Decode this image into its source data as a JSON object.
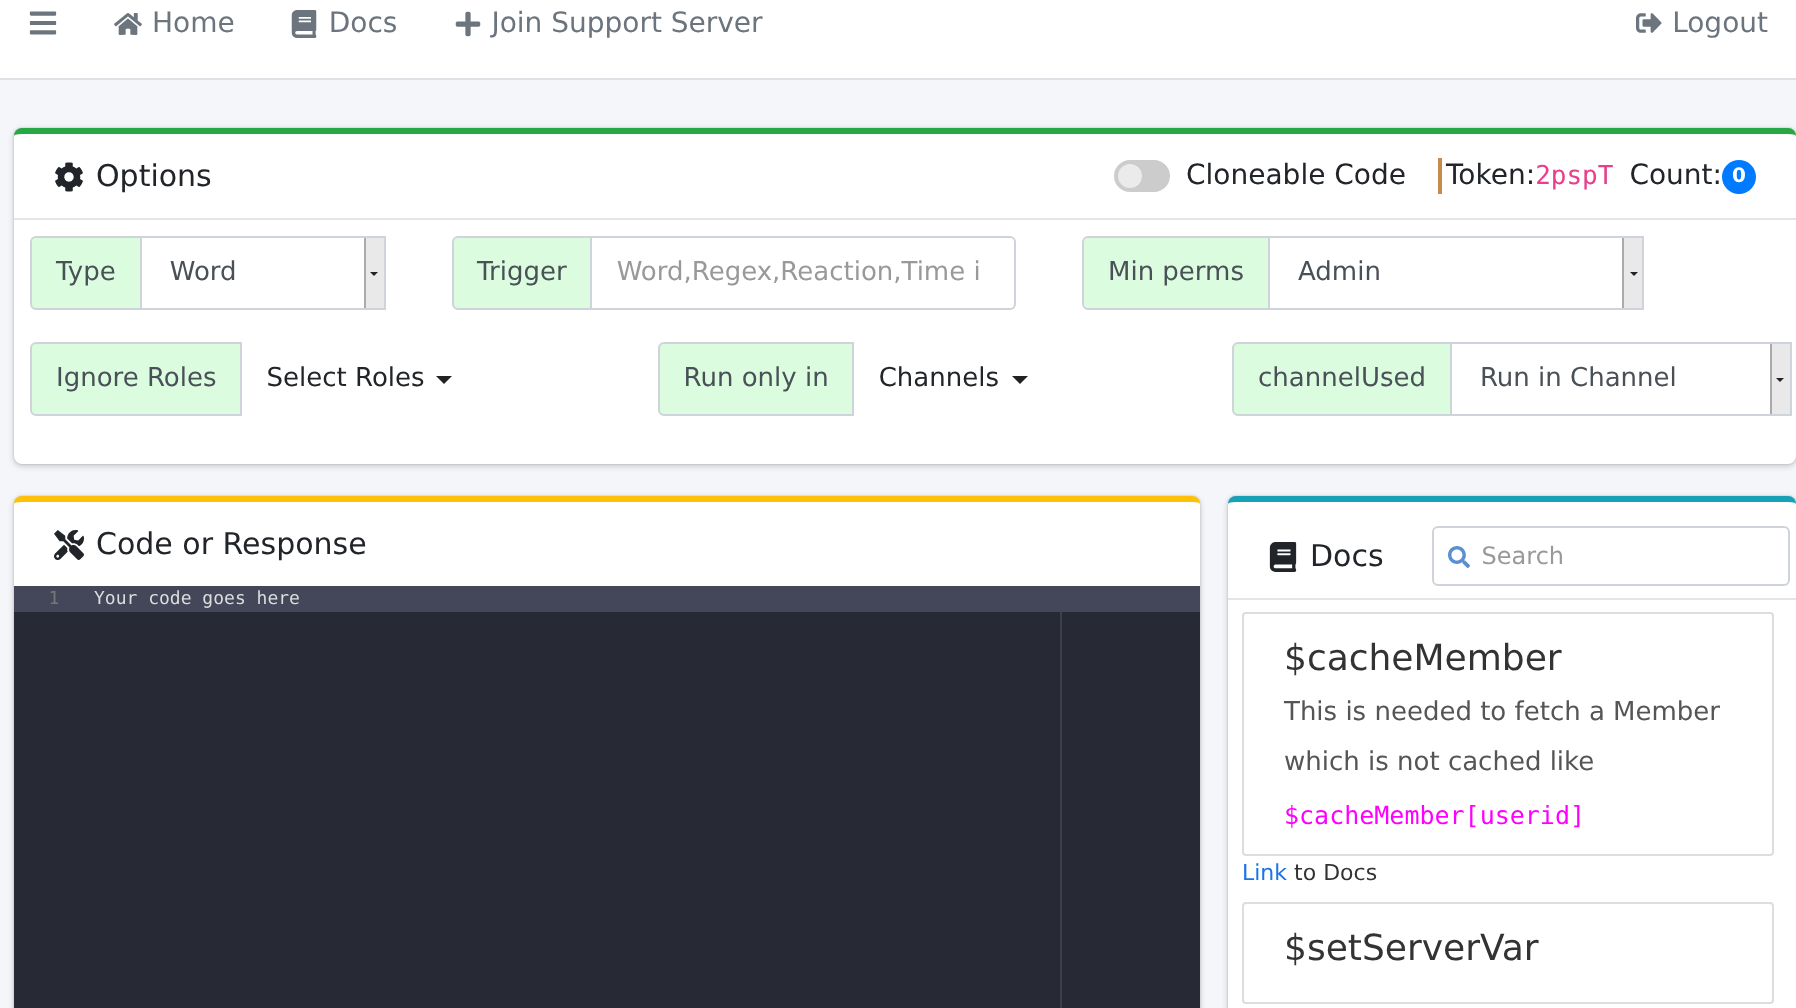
{
  "navbar": {
    "links": [
      {
        "kind": "home",
        "label": "Home"
      },
      {
        "kind": "book",
        "label": "Docs"
      },
      {
        "kind": "plus",
        "label": "Join Support Server"
      }
    ],
    "logout": "Logout"
  },
  "options": {
    "title": "Options",
    "toggle": {
      "label": "Cloneable Code",
      "on": false
    },
    "token_label": "Token:",
    "token": "2pspT",
    "count_label": "Count:",
    "count": "0",
    "row1": [
      {
        "kind": "select",
        "label": "Type",
        "value": "Word"
      },
      {
        "kind": "input",
        "label": "Trigger",
        "placeholder": "Word,Regex,Reaction,Time i"
      },
      {
        "kind": "select",
        "label": "Min perms",
        "value": "Admin"
      }
    ],
    "row2": [
      {
        "kind": "dropdown",
        "label": "Ignore Roles",
        "value": "Select Roles"
      },
      {
        "kind": "dropdown",
        "label": "Run only in",
        "value": "Channels"
      },
      {
        "kind": "select",
        "label": "channelUsed",
        "value": "Run in Channel"
      }
    ]
  },
  "code": {
    "title": "Code or Response",
    "lines": [
      {
        "number": "1",
        "text": "Your code goes here"
      }
    ]
  },
  "docs": {
    "title": "Docs",
    "search_placeholder": "Search",
    "entries": [
      {
        "name": "$cacheMember",
        "description": "This is needed to fetch a Member which is not cached like",
        "example": "$cacheMember[userid]",
        "link": "Link",
        "link_suffix": "to Docs"
      },
      {
        "name": "$setServerVar"
      }
    ]
  }
}
